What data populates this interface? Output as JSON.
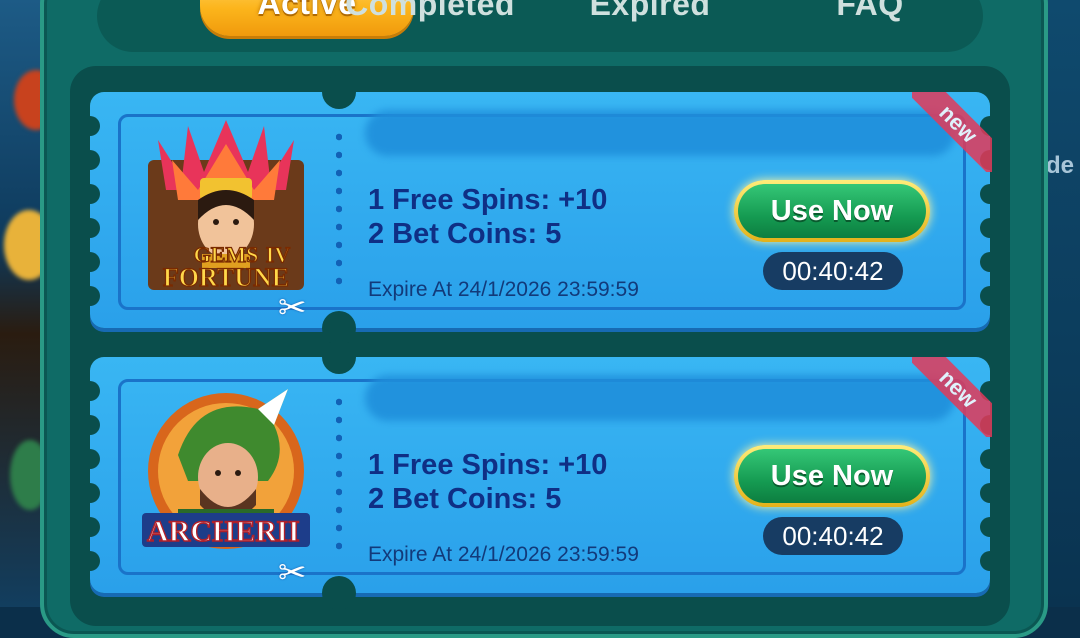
{
  "tabs": [
    {
      "label": "Active",
      "active": true
    },
    {
      "label": "Completed",
      "active": false
    },
    {
      "label": "Expired",
      "active": false
    },
    {
      "label": "FAQ",
      "active": false
    }
  ],
  "side_text": "de",
  "coupons": [
    {
      "game_logo_text": [
        "GEMS",
        "IV",
        "FORTUNE"
      ],
      "free_spins": "1 Free Spins: +10",
      "bet_coins": "2 Bet Coins: 5",
      "expire": "Expire At 24/1/2026 23:59:59",
      "button": "Use Now",
      "timer": "00:40:42",
      "badge": "new"
    },
    {
      "game_logo_text": [
        "ARCHER",
        "II"
      ],
      "free_spins": "1 Free Spins: +10",
      "bet_coins": "2 Bet Coins: 5",
      "expire": "Expire At 24/1/2026 23:59:59",
      "button": "Use Now",
      "timer": "00:40:42",
      "badge": "new"
    }
  ],
  "colors": {
    "accent_gold": "#fcb51c",
    "button_green": "#159b52",
    "ticket_blue": "#2aa0ea",
    "panel_teal": "#0f6b66",
    "badge_red": "#e23a5a"
  },
  "icons": [
    "scissors-icon",
    "gems-of-fortune-game-icon",
    "archer-game-icon"
  ]
}
